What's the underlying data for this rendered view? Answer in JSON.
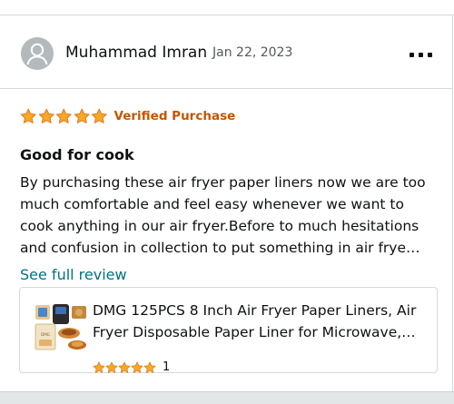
{
  "review": {
    "author": "Muhammad Imran",
    "separator": "·",
    "date": "Jan 22, 2023",
    "more_icon": "more-dots-icon",
    "rating": 5,
    "rating_max": 5,
    "verified_label": "Verified Purchase",
    "title": "Good for cook",
    "body_lines": [
      "By purchasing these air fryer paper liners now we are too",
      "much comfortable and feel easy whenever we want to",
      "cook anything in our air fryer.Before to much hesitations",
      "and confusion in collection to put something in air frye…"
    ],
    "see_full_label": "See full review"
  },
  "product": {
    "name_lines": [
      "DMG 125PCS 8 Inch Air Fryer Paper Liners, Air",
      "Fryer Disposable Paper Liner for Microwave,…"
    ],
    "rating": 5,
    "rating_count": "1"
  },
  "colors": {
    "star": "#f7a825",
    "star_stroke": "#de7921",
    "verified": "#c45500",
    "link": "#007185"
  }
}
